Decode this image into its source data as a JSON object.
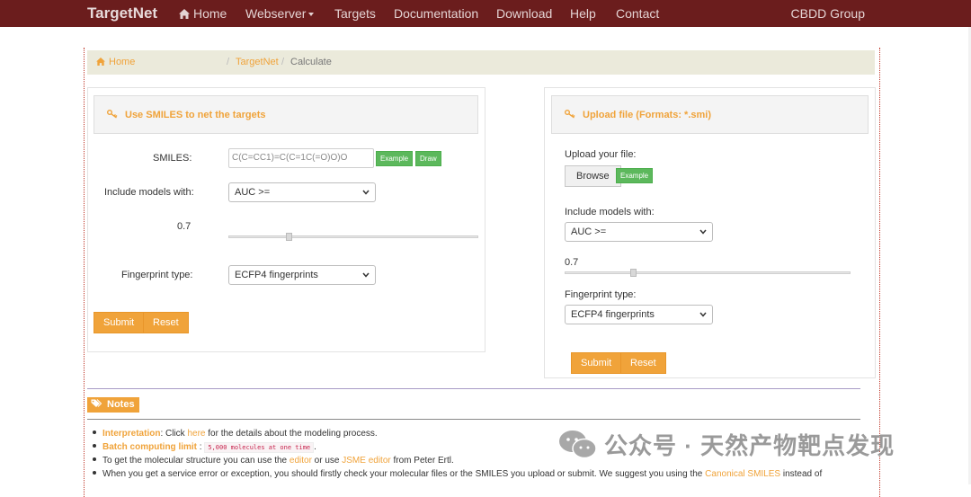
{
  "navbar": {
    "brand": "TargetNet",
    "items": [
      "Home",
      "Webserver",
      "Targets",
      "Documentation",
      "Download",
      "Help",
      "Contact"
    ],
    "right": "CBDD Group"
  },
  "breadcrumb": {
    "home": "Home",
    "targetnet": "TargetNet",
    "current": "Calculate",
    "separator": "/"
  },
  "left_panel": {
    "title": "Use SMILES to net the targets",
    "smiles_label": "SMILES:",
    "smiles_value": "C(C=CC1)=C(C=1C(=O)O)O",
    "example_btn": "Example",
    "draw_btn": "Draw",
    "models_label": "Include models with:",
    "models_select": "AUC >=",
    "threshold": "0.7",
    "threshold_fraction": 0.24,
    "fp_label": "Fingerprint type:",
    "fp_select": "ECFP4 fingerprints",
    "submit": "Submit",
    "reset": "Reset"
  },
  "right_panel": {
    "title": "Upload file (Formats: *.smi)",
    "upload_label": "Upload your file:",
    "browse_btn": "Browse",
    "example_btn": "Example",
    "models_label": "Include models with:",
    "models_select": "AUC >=",
    "threshold": "0.7",
    "threshold_fraction": 0.24,
    "fp_label": "Fingerprint type:",
    "fp_select": "ECFP4 fingerprints",
    "submit": "Submit",
    "reset": "Reset"
  },
  "notes": {
    "heading": "Notes",
    "n1_key": "Interpretation",
    "n1_colon": ": Click ",
    "n1_link": "here",
    "n1_rest": " for the details about the modeling process.",
    "n2_key": "Batch computing limit",
    "n2_colon": " : ",
    "n2_code": "5,000 molecules at one time",
    "n2_dot": ".",
    "n3_a": "To get the molecular structure you can use the ",
    "n3_link1": "editor",
    "n3_b": " or use ",
    "n3_link2": "JSME editor",
    "n3_c": " from Peter Ertl.",
    "n4_a": "When you get a service error or exception, you should firstly check your molecular files or the SMILES you upload or submit. We suggest you using the ",
    "n4_link": "Canonical SMILES",
    "n4_b": " instead of"
  },
  "watermark": "公众号 · 天然产物靶点发现",
  "colors": {
    "navbar": "#6b1d1d",
    "accent": "#f0a33a",
    "green": "#5cb85c"
  }
}
